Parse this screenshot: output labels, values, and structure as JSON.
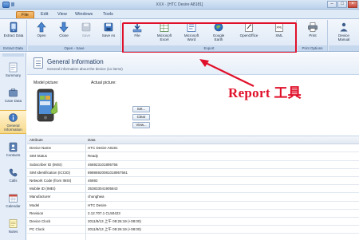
{
  "window": {
    "title": "XXX · [HTC Desire A8181]"
  },
  "menu": {
    "tabs": [
      {
        "label": "File",
        "active": true
      },
      {
        "label": "Edit",
        "active": false
      },
      {
        "label": "View",
        "active": false
      },
      {
        "label": "Windows",
        "active": false
      },
      {
        "label": "Tools",
        "active": false
      }
    ]
  },
  "ribbon": {
    "groups": [
      {
        "label": "Extract Data",
        "buttons": [
          {
            "label": "Extract Data",
            "icon": "extract-icon"
          }
        ]
      },
      {
        "label": "Open - Save",
        "buttons": [
          {
            "label": "Open",
            "icon": "open-arrow-icon"
          },
          {
            "label": "Close",
            "icon": "close-arrow-icon"
          },
          {
            "label": "Save",
            "icon": "save-icon"
          },
          {
            "label": "Save As",
            "icon": "save-as-icon"
          }
        ]
      },
      {
        "label": "Export",
        "buttons": [
          {
            "label": "File",
            "icon": "file-export-icon"
          },
          {
            "label": "Microsoft Excel",
            "icon": "excel-icon"
          },
          {
            "label": "Microsoft Word",
            "icon": "word-icon"
          },
          {
            "label": "Google Earth",
            "icon": "google-earth-icon"
          },
          {
            "label": "OpenOffice",
            "icon": "openoffice-icon"
          },
          {
            "label": "XML",
            "icon": "xml-icon"
          }
        ]
      },
      {
        "label": "Print Options",
        "buttons": [
          {
            "label": "Print",
            "icon": "printer-icon"
          }
        ]
      },
      {
        "label": "",
        "buttons": [
          {
            "label": "Device Manual",
            "icon": "manual-icon"
          }
        ]
      }
    ]
  },
  "sidebar": {
    "items": [
      {
        "label": "Summary",
        "icon": "summary-icon"
      },
      {
        "label": "Case Data",
        "icon": "case-data-icon"
      },
      {
        "label": "General Information",
        "icon": "info-icon",
        "active": true
      },
      {
        "label": "Contacts",
        "icon": "contacts-icon"
      },
      {
        "label": "Calls",
        "icon": "calls-icon"
      },
      {
        "label": "Calendar",
        "icon": "calendar-icon"
      },
      {
        "label": "Notes",
        "icon": "notes-icon"
      }
    ]
  },
  "content": {
    "title": "General Information",
    "subtitle": "General information about the device (11 items)",
    "model_picture_label": "Model picture:",
    "actual_picture_label": "Actual picture:",
    "buttons": {
      "set": "Set...",
      "clear": "Clear",
      "view": "View..."
    }
  },
  "annotation": {
    "text": "Report 工具",
    "color": "#e0102a"
  },
  "table": {
    "headers": [
      "Attribute",
      "Data"
    ],
    "rows": [
      [
        "Device Name",
        "HTC Desire A8181"
      ],
      [
        "SIM Status",
        "Ready"
      ],
      [
        "Subscriber ID (IMSI)",
        "466923101895756"
      ],
      [
        "SIM Identification (ICCID)",
        "89886920081018957561"
      ],
      [
        "Network Code (from IMSI)",
        "46692"
      ],
      [
        "Mobile ID (IMEI)",
        "353833041905843"
      ],
      [
        "Manufacturer",
        "chunghwa"
      ],
      [
        "Model",
        "HTC Desire"
      ],
      [
        "Revision",
        "2.12.707.1 CL50423"
      ],
      [
        "Device Clock",
        "2011/9/13 上午 09:26:19 (+08:00)"
      ],
      [
        "PC Clock",
        "2011/9/13 上午 09:26:19 (+08:00)"
      ]
    ]
  },
  "colors": {
    "accent": "#e0102a",
    "ribbon_bg": "#dce7f5",
    "active_tab": "#e59a3c"
  }
}
